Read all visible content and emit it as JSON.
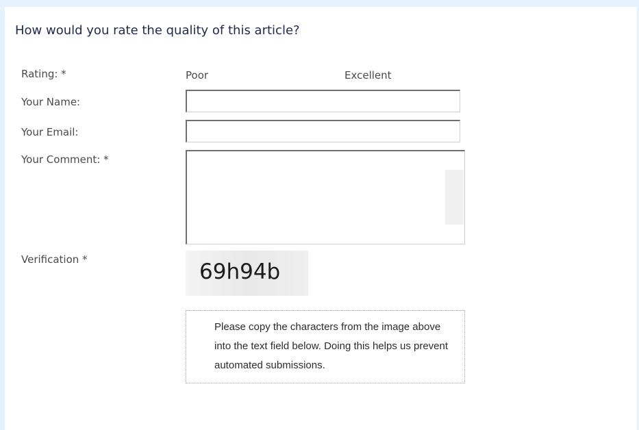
{
  "form": {
    "title": "How would you rate the quality of this article?",
    "rating": {
      "label": "Rating: *",
      "low_label": "Poor",
      "high_label": "Excellent"
    },
    "name": {
      "label": "Your Name:",
      "value": ""
    },
    "email": {
      "label": "Your Email:",
      "value": ""
    },
    "comment": {
      "label": "Your Comment: *",
      "value": ""
    },
    "verification": {
      "label": "Verification *",
      "captcha_text": "69h94b",
      "help_text": "Please copy the characters from the image above into the text field below. Doing this helps us prevent automated submissions."
    }
  }
}
